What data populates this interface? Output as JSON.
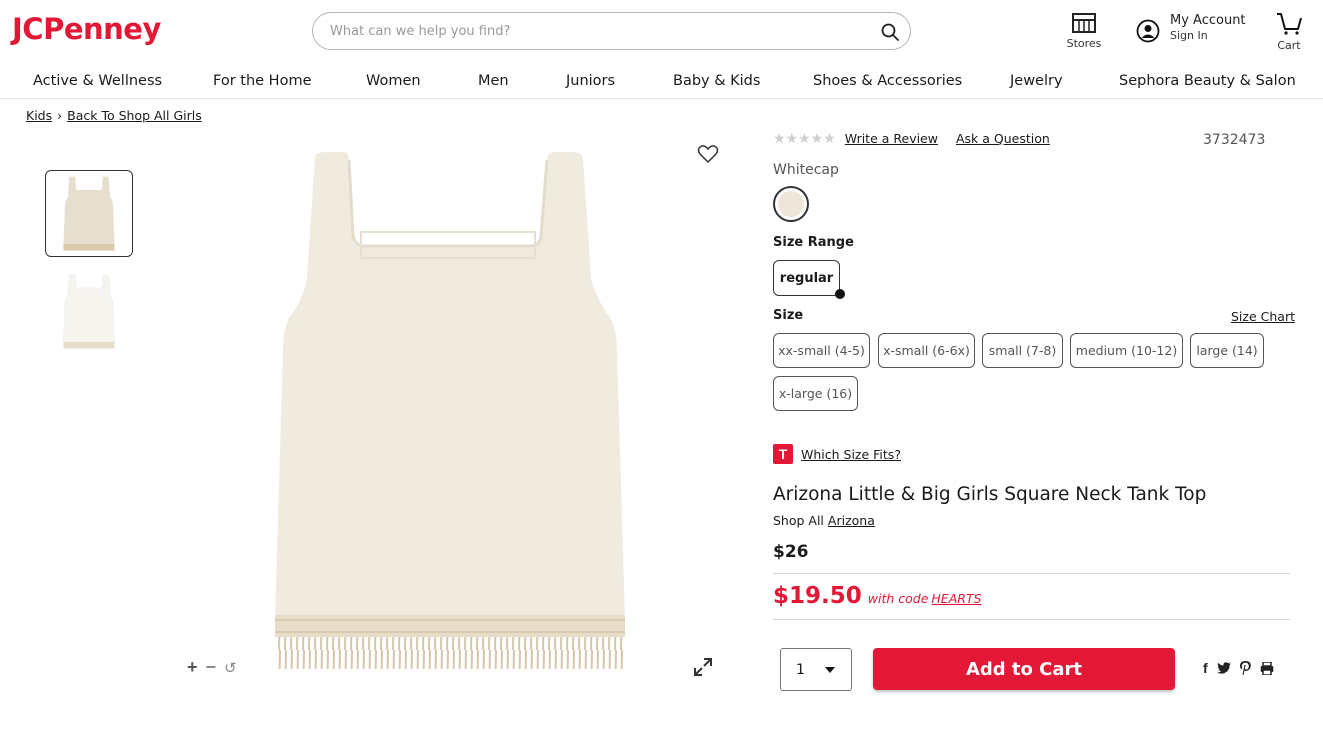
{
  "header": {
    "logo": "JCPenney",
    "search_placeholder": "What can we help you find?",
    "stores_label": "Stores",
    "account_title": "My Account",
    "account_sub": "Sign In",
    "cart_label": "Cart"
  },
  "nav": [
    "Active & Wellness",
    "For the Home",
    "Women",
    "Men",
    "Juniors",
    "Baby & Kids",
    "Shoes & Accessories",
    "Jewelry",
    "Sephora Beauty & Salon"
  ],
  "breadcrumb": {
    "kids": "Kids",
    "back": "Back To Shop All Girls"
  },
  "product": {
    "review_link": "Write a Review",
    "question_link": "Ask a Question",
    "sku": "3732473",
    "color_name": "Whitecap",
    "size_range_label": "Size Range",
    "size_range_selected": "regular",
    "size_label": "Size",
    "size_chart": "Size Chart",
    "sizes": [
      "xx-small (4-5)",
      "x-small (6-6x)",
      "small (7-8)",
      "medium (10-12)",
      "large (14)",
      "x-large (16)"
    ],
    "fit_label": "Which Size Fits?",
    "fit_icon_letter": "T",
    "title": "Arizona Little & Big Girls Square Neck Tank Top",
    "shop_all_prefix": "Shop All",
    "brand": "Arizona",
    "price": "$26",
    "sale_price": "$19.50",
    "sale_text": "with code",
    "promo_code": "HEARTS",
    "quantity": "1",
    "add_to_cart": "Add to Cart",
    "rating_stars": 0
  },
  "colors": {
    "brand_red": "#e31837",
    "swatch": "#ede6d9",
    "garment": "#efebdf"
  }
}
